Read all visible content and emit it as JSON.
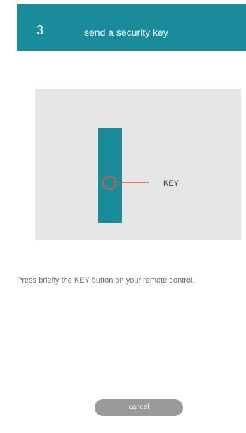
{
  "header": {
    "step_number": "3",
    "title": "send a security key"
  },
  "illustration": {
    "key_label": "KEY",
    "icon": "remote-control-key-diagram"
  },
  "instruction": {
    "text": "Press briefly the KEY button on your remote control."
  },
  "actions": {
    "cancel_label": "cancel"
  },
  "colors": {
    "header_bg": "#1a8b9b",
    "remote_body": "#1a8b9b",
    "key_highlight": "#d45a3a",
    "illustration_bg": "#e6e6e6",
    "cancel_bg": "#9a9a9a"
  }
}
